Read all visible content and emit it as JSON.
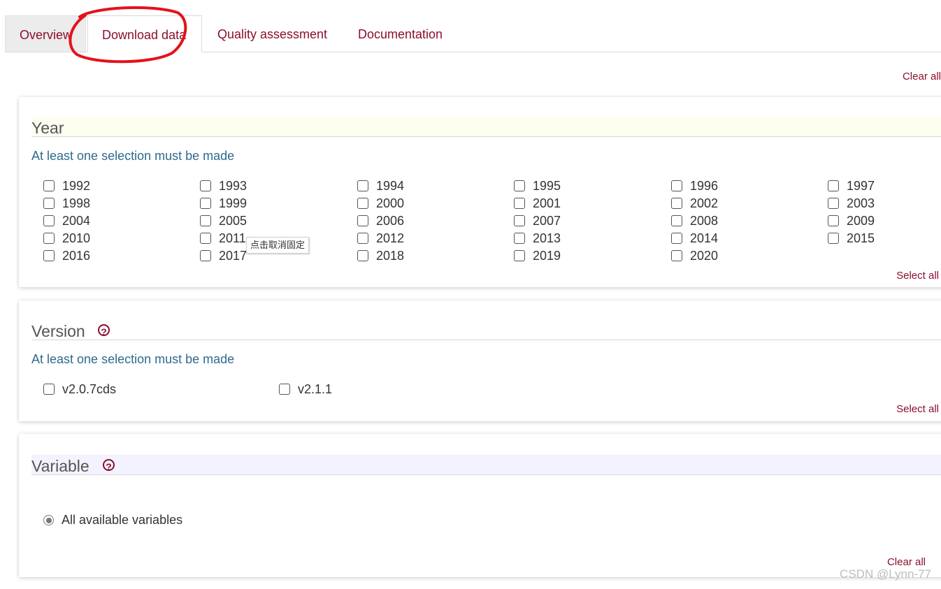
{
  "tabs": {
    "overview": "Overview",
    "download": "Download data",
    "quality": "Quality assessment",
    "documentation": "Documentation"
  },
  "clear_all_top": "Clear all",
  "year": {
    "title": "Year",
    "subtitle": "At least one selection must be made",
    "options": [
      "1992",
      "1993",
      "1994",
      "1995",
      "1996",
      "1997",
      "1998",
      "1999",
      "2000",
      "2001",
      "2002",
      "2003",
      "2004",
      "2005",
      "2006",
      "2007",
      "2008",
      "2009",
      "2010",
      "2011",
      "2012",
      "2013",
      "2014",
      "2015",
      "2016",
      "2017",
      "2018",
      "2019",
      "2020"
    ],
    "select_all": "Select all"
  },
  "tooltip": "点击取消固定",
  "version": {
    "title": "Version",
    "help": "?",
    "subtitle": "At least one selection must be made",
    "options": [
      "v2.0.7cds",
      "v2.1.1"
    ],
    "select_all": "Select all"
  },
  "variable": {
    "title": "Variable",
    "help": "?",
    "option": "All available variables",
    "clear_all": "Clear all"
  },
  "watermark": "CSDN @Lynn-77",
  "colors": {
    "accent": "#8b0f2e",
    "subtitle": "#2e6b8c",
    "annotation": "#e3121b"
  }
}
